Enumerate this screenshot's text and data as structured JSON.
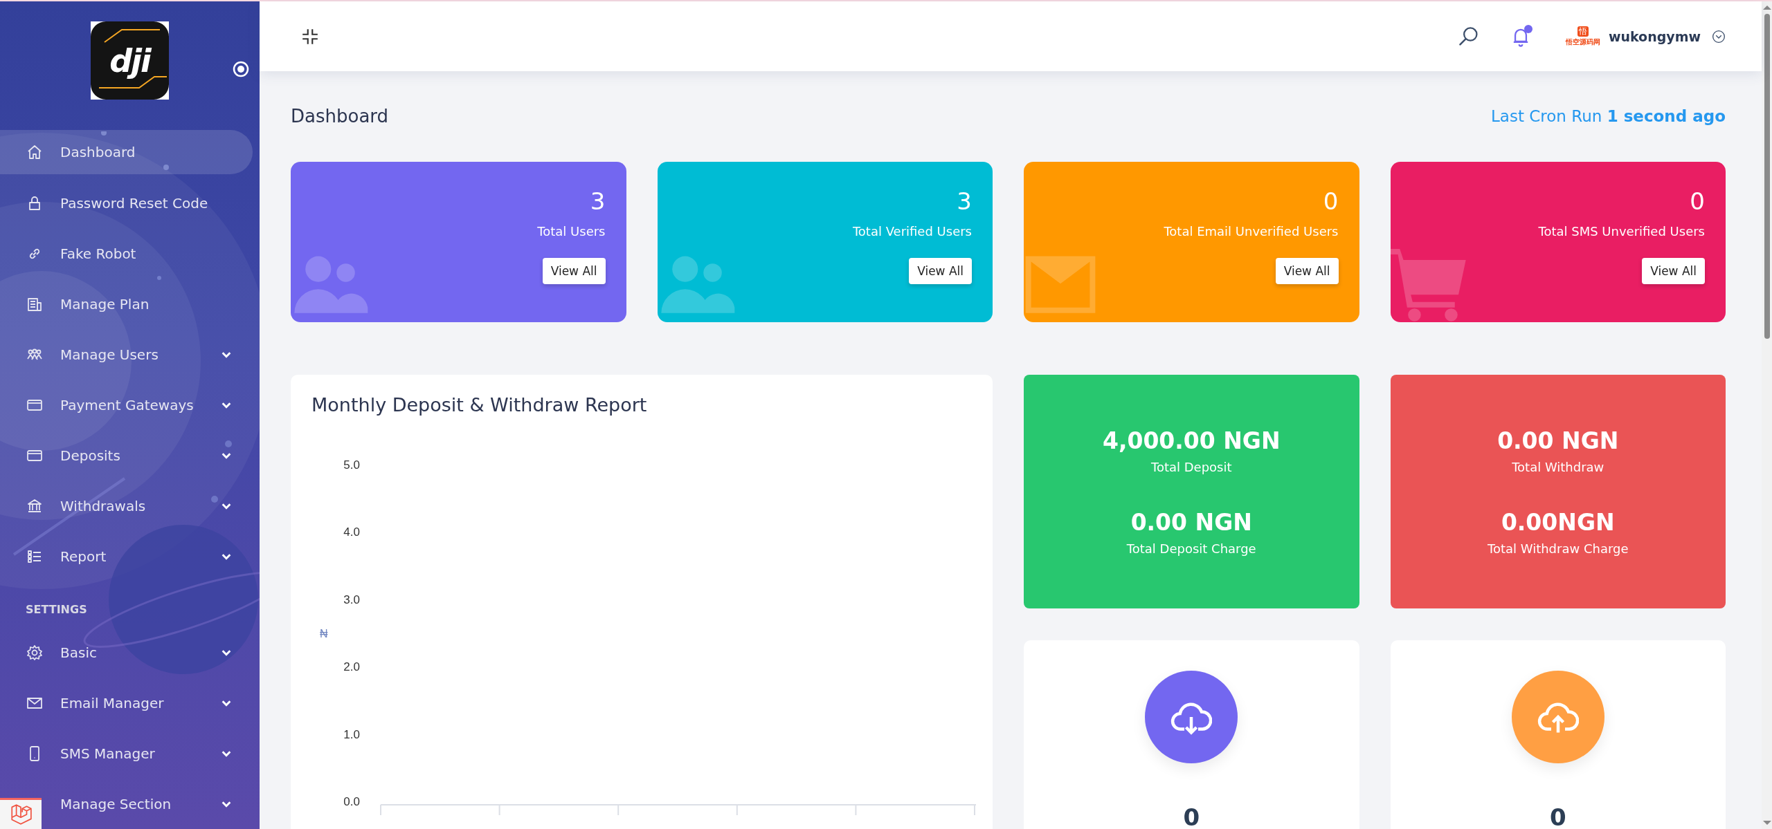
{
  "sidebar": {
    "logo_text": "dji",
    "sections": [
      {
        "items": [
          {
            "label": "Dashboard",
            "selected": true,
            "expandable": false
          },
          {
            "label": "Password Reset Code",
            "selected": false,
            "expandable": false
          },
          {
            "label": "Fake Robot",
            "selected": false,
            "expandable": false
          },
          {
            "label": "Manage Plan",
            "selected": false,
            "expandable": false
          },
          {
            "label": "Manage Users",
            "selected": false,
            "expandable": true
          },
          {
            "label": "Payment Gateways",
            "selected": false,
            "expandable": true
          },
          {
            "label": "Deposits",
            "selected": false,
            "expandable": true
          },
          {
            "label": "Withdrawals",
            "selected": false,
            "expandable": true
          },
          {
            "label": "Report",
            "selected": false,
            "expandable": true
          }
        ]
      },
      {
        "heading": "SETTINGS",
        "items": [
          {
            "label": "Basic",
            "selected": false,
            "expandable": true
          },
          {
            "label": "Email Manager",
            "selected": false,
            "expandable": true
          },
          {
            "label": "SMS Manager",
            "selected": false,
            "expandable": true
          },
          {
            "label": "Manage Section",
            "selected": false,
            "expandable": true
          }
        ]
      }
    ]
  },
  "header": {
    "has_notifications": true,
    "avatar": {
      "badge": "悟",
      "caption": "悟空源码网"
    },
    "username": "wukongymw"
  },
  "page": {
    "title": "Dashboard",
    "cron": "Last Cron Run **1 second ago**"
  },
  "stat_cards": [
    {
      "value": "3",
      "label": "Total Users",
      "button": "View All",
      "color": "#7367f0"
    },
    {
      "value": "3",
      "label": "Total Verified Users",
      "button": "View All",
      "color": "#00bcd4"
    },
    {
      "value": "0",
      "label": "Total Email Unverified Users",
      "button": "View All",
      "color": "#ff9800"
    },
    {
      "value": "0",
      "label": "Total SMS Unverified Users",
      "button": "View All",
      "color": "#e91e63"
    }
  ],
  "report": {
    "title": "Monthly Deposit & Withdraw Report",
    "y_unit": "₦",
    "y_axis_labels": [
      "5.0",
      "4.0",
      "3.0",
      "2.0",
      "1.0",
      "0.0"
    ]
  },
  "total_cards": [
    {
      "color": "#28c76f",
      "rows": [
        {
          "value": "4,000.00 NGN",
          "label": "Total Deposit"
        },
        {
          "value": "0.00 NGN",
          "label": "Total Deposit Charge"
        }
      ]
    },
    {
      "color": "#ea5455",
      "rows": [
        {
          "value": "0.00 NGN",
          "label": "Total Withdraw"
        },
        {
          "value": "0.00NGN",
          "label": "Total Withdraw Charge"
        }
      ]
    }
  ],
  "count_cards": [
    {
      "value": "0",
      "color": "#7367f0"
    },
    {
      "value": "0",
      "color": "#ff9f43"
    }
  ]
}
